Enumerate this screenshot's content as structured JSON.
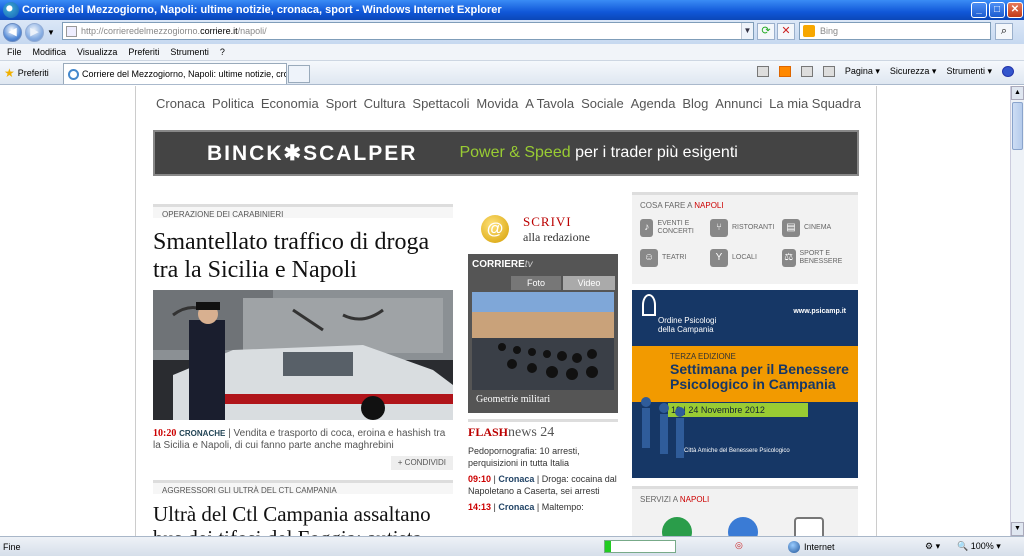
{
  "window": {
    "title": "Corriere del Mezzogiorno, Napoli: ultime notizie, cronaca, sport - Windows Internet Explorer",
    "minimize": "_",
    "maximize": "□",
    "close": "✕"
  },
  "address": {
    "url_prefix": "http://corrieredelmezzogiorno.",
    "url_domain": "corriere.it",
    "url_path": "/napoli/",
    "search_placeholder": "Bing"
  },
  "menu": [
    "File",
    "Modifica",
    "Visualizza",
    "Preferiti",
    "Strumenti",
    "?"
  ],
  "favorites_label": "Preferiti",
  "tab_title": "Corriere del Mezzogiorno, Napoli: ultime notizie, crona...",
  "commands": {
    "pagina": "Pagina ▾",
    "sicurezza": "Sicurezza ▾",
    "strumenti": "Strumenti ▾"
  },
  "status": {
    "text": "Fine",
    "zone": "Internet",
    "zoom": "100%",
    "progress": 0.08
  },
  "site": {
    "nav": [
      "Cronaca",
      "Politica",
      "Economia",
      "Sport",
      "Cultura",
      "Spettacoli",
      "Movida",
      "A Tavola",
      "Sociale",
      "Agenda",
      "Blog",
      "Annunci",
      "La mia Squadra"
    ],
    "banner": {
      "brand": "BINCK✱SCALPER",
      "slogan_a": "Power & Speed",
      "slogan_b": " per i trader più esigenti"
    },
    "story1": {
      "kicker": "OPERAZIONE DEI CARABINIERI",
      "headline": "Smantellato traffico di droga tra la Sicilia e Napoli",
      "time": "10:20",
      "category": "CRONACHE",
      "summary": "Vendita e trasporto di coca, eroina e hashish tra la Sicilia e Napoli, di cui fanno parte anche maghrebini",
      "share": "+ CONDIVIDI"
    },
    "story2": {
      "kicker": "AGGRESSORI GLI ULTRÀ DEL CTL CAMPANIA",
      "headline": "Ultrà del Ctl Campania assaltano bus dei tifosi del Foggia: autista ferito"
    },
    "scrivi": {
      "line1": "SCRIVI",
      "line2": "alla redazione"
    },
    "tv": {
      "logo": "CORRIERE",
      "logo_suffix": "tv",
      "tab_foto": "Foto",
      "tab_video": "Video",
      "caption": "Geometrie militari"
    },
    "flash": {
      "title_a": "FLASH",
      "title_b": "news 24",
      "items": [
        {
          "time": "",
          "category": "",
          "text": "Pedopornografia: 10 arresti, perquisizioni in tutta Italia"
        },
        {
          "time": "09:10",
          "category": "Cronaca",
          "text": "Droga: cocaina dal Napoletano a Caserta, sei arresti"
        },
        {
          "time": "14:13",
          "category": "Cronaca",
          "text": "Maltempo:"
        }
      ]
    },
    "cosa": {
      "header_a": "COSA FARE A ",
      "header_b": "NAPOLI",
      "items": [
        "EVENTI E CONCERTI",
        "RISTORANTI",
        "CINEMA",
        "TEATRI",
        "LOCALI",
        "SPORT E BENESSERE"
      ]
    },
    "ad2": {
      "org": "Ordine Psicologi della Campania",
      "url": "www.psicamp.it",
      "edition": "TERZA EDIZIONE",
      "title": "Settimana per il Benessere Psicologico in Campania",
      "dates": "19 | 24 Novembre 2012",
      "footer": "Città Amiche del Benessere Psicologico"
    },
    "servizi": {
      "header_a": "SERVIZI A ",
      "header_b": "NAPOLI"
    }
  }
}
